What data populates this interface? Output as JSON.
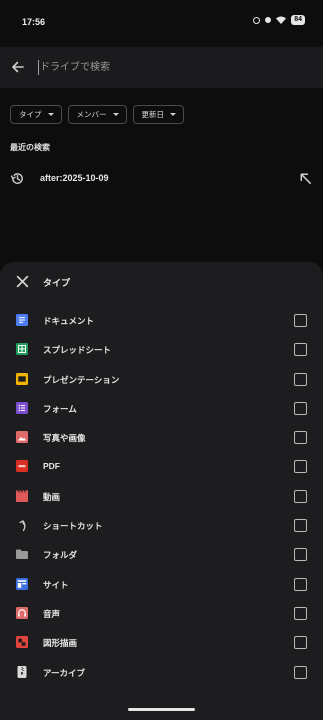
{
  "status_bar": {
    "time": "17:56",
    "battery": "84"
  },
  "search": {
    "placeholder": "ドライブで検索",
    "value": ""
  },
  "filters": [
    {
      "label": "タイプ"
    },
    {
      "label": "メンバー"
    },
    {
      "label": "更新日"
    }
  ],
  "recent": {
    "title": "最近の検索",
    "items": [
      {
        "text": "after:2025-10-09"
      }
    ]
  },
  "type_sheet": {
    "title": "タイプ",
    "items": [
      {
        "label": "ドキュメント",
        "icon": "docs-icon",
        "color": "#4c7cf0",
        "checked": false
      },
      {
        "label": "スプレッドシート",
        "icon": "sheets-icon",
        "color": "#1e9e5a",
        "checked": false
      },
      {
        "label": "プレゼンテーション",
        "icon": "slides-icon",
        "color": "#f4b400",
        "checked": false
      },
      {
        "label": "フォーム",
        "icon": "forms-icon",
        "color": "#7c4dcc",
        "checked": false
      },
      {
        "label": "写真や画像",
        "icon": "image-icon",
        "color": "#e06b6b",
        "checked": false
      },
      {
        "label": "PDF",
        "icon": "pdf-icon",
        "color": "#d93025",
        "checked": false
      },
      {
        "label": "動画",
        "icon": "video-icon",
        "color": "#e05a5a",
        "checked": false
      },
      {
        "label": "ショートカット",
        "icon": "shortcut-icon",
        "color": "#cfcfcf",
        "checked": false
      },
      {
        "label": "フォルダ",
        "icon": "folder-icon",
        "color": "#9a9a9a",
        "checked": false
      },
      {
        "label": "サイト",
        "icon": "sites-icon",
        "color": "#3b6fe0",
        "checked": false
      },
      {
        "label": "音声",
        "icon": "audio-icon",
        "color": "#e06b6b",
        "checked": false
      },
      {
        "label": "図形描画",
        "icon": "drawing-icon",
        "color": "#e0443a",
        "checked": false
      },
      {
        "label": "アーカイブ",
        "icon": "archive-icon",
        "color": "#d9d9d9",
        "checked": false
      }
    ]
  }
}
